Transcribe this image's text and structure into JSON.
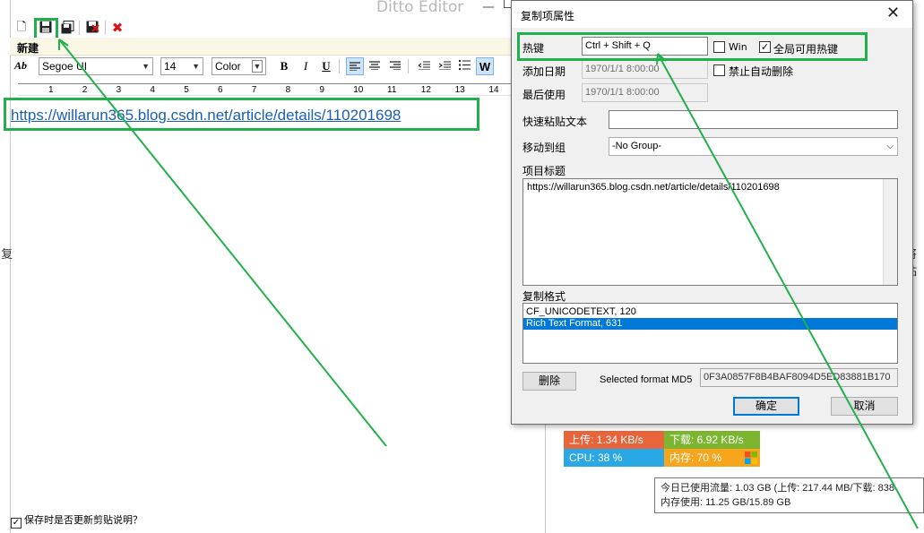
{
  "editor": {
    "title": "Ditto Editor",
    "tab_label": "新建",
    "font_name": "Segoe UI",
    "font_size": "14",
    "color_label": "Color",
    "bold": "B",
    "italic": "I",
    "underline": "U",
    "w_button": "W",
    "font_style_icon": "Ab",
    "ruler_ticks": [
      "1",
      "2",
      "3",
      "4",
      "5",
      "6",
      "7",
      "8",
      "9",
      "10",
      "11",
      "12",
      "13",
      "14"
    ],
    "content_text": "https://willarun365.blog.csdn.net/article/details/110201698",
    "bottom_checkbox_label": "保存时是否更新剪贴说明？",
    "bottom_checkbox_checked": true
  },
  "background_fragments": {
    "left": ")复",
    "right": "将粘"
  },
  "dialog": {
    "title": "复制项属性",
    "hotkey_label": "热键",
    "hotkey_value": "Ctrl + Shift + Q",
    "win_label": "Win",
    "win_checked": false,
    "global_hotkey_label": "全局可用热键",
    "global_hotkey_checked": true,
    "added_date_label": "添加日期",
    "added_date_value": "1970/1/1 8:00:00",
    "no_auto_delete_label": "禁止自动删除",
    "no_auto_delete_checked": false,
    "last_used_label": "最后使用",
    "last_used_value": "1970/1/1 8:00:00",
    "quick_paste_label": "快速粘贴文本",
    "quick_paste_value": "",
    "move_to_group_label": "移动到组",
    "move_to_group_value": "-No Group-",
    "item_title_label": "项目标题",
    "item_title_value": "https://willarun365.blog.csdn.net/article/details/110201698",
    "copy_formats_label": "复制格式",
    "formats": [
      {
        "label": "CF_UNICODETEXT, 120",
        "selected": false
      },
      {
        "label": "Rich Text Format, 631",
        "selected": true
      }
    ],
    "delete_button": "删除",
    "md5_label": "Selected format MD5",
    "md5_value": "0F3A0857F8B4BAF8094D5ED83881B170",
    "ok_button": "确定",
    "cancel_button": "取消"
  },
  "net_monitor": {
    "upload": "上传: 1.34 KB/s",
    "download": "下载: 6.92 KB/s",
    "cpu": "CPU: 38 %",
    "memory": "内存: 70 %",
    "colors": {
      "upload": "#e8643a",
      "download": "#7cb530",
      "cpu": "#2aa8e6",
      "memory": "#f7a51c"
    }
  },
  "tooltip": {
    "line1": "今日已使用流量: 1.03 GB (上传: 217.44 MB/下载: 838",
    "line2": "内存使用: 11.25 GB/15.89 GB"
  },
  "annotation_color": "#21b04b"
}
